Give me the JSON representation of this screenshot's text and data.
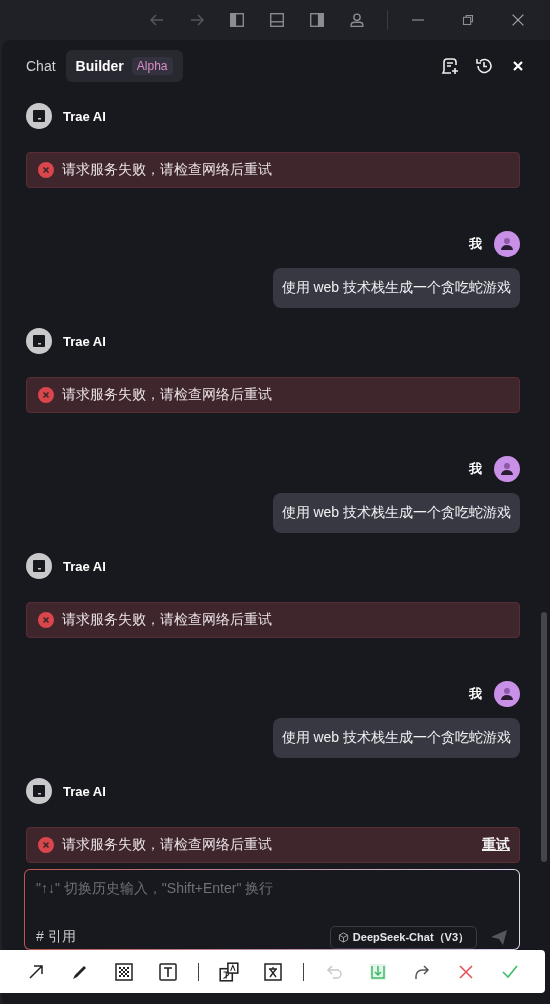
{
  "tabs": [
    {
      "label": "Chat",
      "selected": false
    },
    {
      "label": "Builder",
      "selected": true,
      "badge": "Alpha"
    }
  ],
  "messages": [
    {
      "kind": "ai",
      "sender": "Trae AI",
      "error": "请求服务失败，请检查网络后重试"
    },
    {
      "kind": "user",
      "sender": "我",
      "text": "使用 web 技术栈生成一个贪吃蛇游戏"
    },
    {
      "kind": "ai",
      "sender": "Trae AI",
      "error": "请求服务失败，请检查网络后重试"
    },
    {
      "kind": "user",
      "sender": "我",
      "text": "使用 web 技术栈生成一个贪吃蛇游戏"
    },
    {
      "kind": "ai",
      "sender": "Trae AI",
      "error": "请求服务失败，请检查网络后重试"
    },
    {
      "kind": "user",
      "sender": "我",
      "text": "使用 web 技术栈生成一个贪吃蛇游戏"
    },
    {
      "kind": "ai",
      "sender": "Trae AI",
      "error": "请求服务失败，请检查网络后重试",
      "action": "重试"
    }
  ],
  "input": {
    "placeholder": "\"↑↓\" 切换历史输入，\"Shift+Enter\" 换行",
    "reference": "# 引用",
    "model": "DeepSeek-Chat（V3）"
  }
}
